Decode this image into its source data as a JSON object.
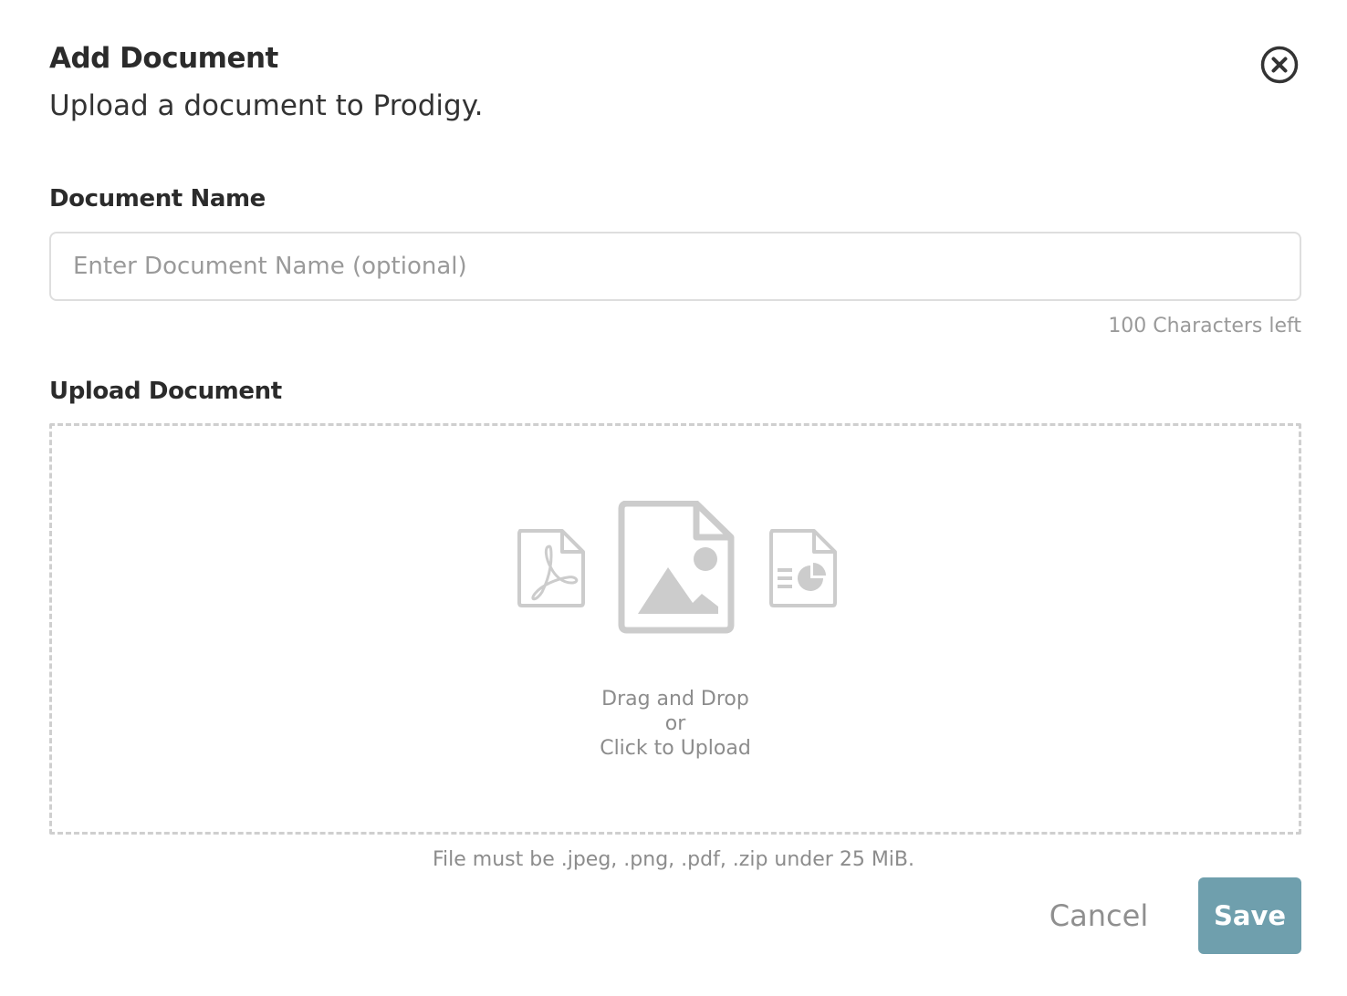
{
  "dialog": {
    "title": "Add Document",
    "subtitle": "Upload a document to Prodigy.",
    "close_icon": "close-circle-icon"
  },
  "name_field": {
    "label": "Document Name",
    "value": "",
    "placeholder": "Enter Document Name (optional)",
    "char_count_text": "100 Characters left"
  },
  "upload": {
    "label": "Upload Document",
    "icons": [
      "pdf-file-icon",
      "image-file-icon",
      "chart-file-icon"
    ],
    "drop_line1": "Drag and Drop",
    "drop_line2": "or",
    "drop_line3": "Click to Upload",
    "hint": "File must be .jpeg, .png, .pdf, .zip under 25 MiB."
  },
  "actions": {
    "cancel_label": "Cancel",
    "save_label": "Save"
  },
  "colors": {
    "save_button": "#6f9fad",
    "icon_gray": "#cccccc",
    "muted_text": "#8c8c8c"
  }
}
